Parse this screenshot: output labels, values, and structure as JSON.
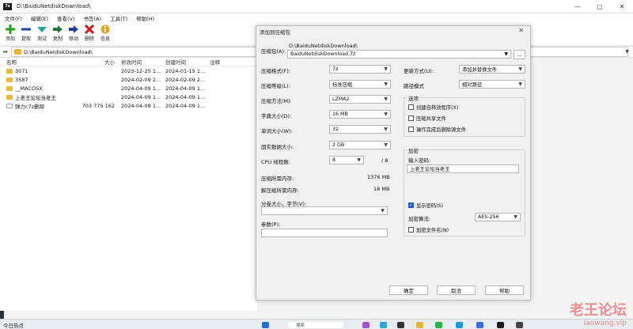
{
  "window": {
    "icon_text": "7z",
    "title": "D:\\BaiduNetdiskDownload\\",
    "minimize": "—",
    "maximize": "▢",
    "close": "✕"
  },
  "menu": [
    "文件(F)",
    "编辑(E)",
    "查看(V)",
    "书签(A)",
    "工具(T)",
    "帮助(H)"
  ],
  "toolbar": {
    "add": "添加",
    "extract": "提取",
    "test": "测试",
    "copy": "复制",
    "move": "移动",
    "delete": "删除",
    "info": "信息"
  },
  "address": {
    "path": "D:\\BaiduNetdiskDownload\\"
  },
  "filelist": {
    "headers": {
      "name": "名称",
      "size": "大小",
      "modified": "修改时间",
      "created": "创建时间",
      "note": "注释"
    },
    "rows": [
      {
        "name": "3071",
        "size": "",
        "modified": "2023-12-25 1...",
        "created": "2024-01-15 1...",
        "type": "folder"
      },
      {
        "name": "3587",
        "size": "",
        "modified": "2024-02-09 2...",
        "created": "2024-02-09 2...",
        "type": "folder"
      },
      {
        "name": "__MACOSX",
        "size": "",
        "modified": "2024-04-09 1...",
        "created": "2024-04-09 1...",
        "type": "folder"
      },
      {
        "name": "上老王论坛当老王",
        "size": "",
        "modified": "2024-04-09 1...",
        "created": "2024-04-09 1...",
        "type": "folder"
      },
      {
        "name": "弹力c7z删除",
        "size": "703 775 162",
        "modified": "2024-04-09 1...",
        "created": "2024-04-09 1...",
        "type": "file"
      }
    ]
  },
  "dialog": {
    "title": "添加到压缩包",
    "archive_label": "压缩包(A):",
    "archive_dir": "D:\\BaiduNetdiskDownload\\",
    "archive_name": "BaiduNetdiskDownload.7z",
    "browse": "...",
    "format_label": "压缩格式(F):",
    "format_value": "7z",
    "level_label": "压缩等级(L):",
    "level_value": "标准压缩",
    "method_label": "压缩方法(M):",
    "method_value": "LZMA2",
    "dict_label": "字典大小(D):",
    "dict_value": "16 MB",
    "word_label": "单词大小(W):",
    "word_value": "32",
    "solid_label": "固实数据大小:",
    "solid_value": "2 GB",
    "threads_label": "CPU 线程数:",
    "threads_value": "8",
    "threads_total": "/ 8",
    "mem_comp_label": "压缩所需内存:",
    "mem_comp_value": "1376 MB",
    "mem_decomp_label": "解压缩所需内存:",
    "mem_decomp_value": "18 MB",
    "split_label": "分卷大小，字节(V):",
    "params_label": "参数(P):",
    "update_label": "更新方式(U):",
    "update_value": "添加并替换文件",
    "pathmode_label": "路径模式",
    "pathmode_value": "相对路径",
    "options_title": "选项",
    "opt_sfx": "创建自释放程序(X)",
    "opt_shared": "压缩共享文件",
    "opt_delete": "操作完成后删除源文件",
    "encrypt_title": "加密",
    "password_label": "输入密码:",
    "password_value": "上老王论坛当老王",
    "show_password": "显示密码(S)",
    "enc_method_label": "加密算法:",
    "enc_method_value": "AES-256",
    "enc_names": "加密文件名(N)",
    "ok": "确定",
    "cancel": "取消",
    "help": "帮助"
  },
  "taskbar": {
    "weather": "今日热点",
    "search": "搜索"
  },
  "watermark": {
    "text": "老王论坛",
    "sub": "laowang.vip"
  }
}
